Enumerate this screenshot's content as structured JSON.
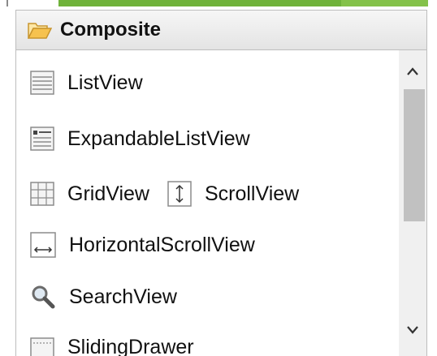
{
  "panel": {
    "title": "Composite",
    "icon": "folder-open-icon"
  },
  "items": [
    {
      "label": "ListView",
      "icon": "list-view-icon"
    },
    {
      "label": "ExpandableListView",
      "icon": "expandable-list-view-icon"
    },
    {
      "label": "GridView",
      "icon": "grid-view-icon"
    },
    {
      "label": "ScrollView",
      "icon": "scroll-view-icon"
    },
    {
      "label": "HorizontalScrollView",
      "icon": "horizontal-scroll-view-icon"
    },
    {
      "label": "SearchView",
      "icon": "search-icon"
    },
    {
      "label": "SlidingDrawer",
      "icon": "sliding-drawer-icon"
    }
  ],
  "scrollbar": {
    "up_icon": "chevron-up-icon",
    "down_icon": "chevron-down-icon"
  },
  "colors": {
    "accent_green": "#6fb23a",
    "header_border": "#bdbdbd",
    "folder_fill": "#f6c24f"
  }
}
